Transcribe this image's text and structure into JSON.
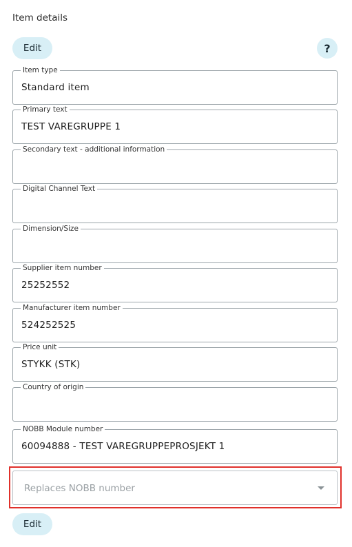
{
  "header": {
    "title": "Item details",
    "edit_label": "Edit",
    "help_label": "?"
  },
  "fields": [
    {
      "label": "Item type",
      "value": "Standard item"
    },
    {
      "label": "Primary text",
      "value": "TEST VAREGRUPPE 1"
    },
    {
      "label": "Secondary text - additional information",
      "value": ""
    },
    {
      "label": "Digital Channel Text",
      "value": ""
    },
    {
      "label": "Dimension/Size",
      "value": ""
    },
    {
      "label": "Supplier item number",
      "value": "25252552"
    },
    {
      "label": "Manufacturer item number",
      "value": "524252525"
    },
    {
      "label": "Price unit",
      "value": "STYKK (STK)"
    },
    {
      "label": "Country of origin",
      "value": ""
    },
    {
      "label": "NOBB Module number",
      "value": "60094888 - TEST VAREGRUPPEPROSJEKT 1"
    }
  ],
  "replaces_nobb": {
    "placeholder": "Replaces NOBB number",
    "value": "",
    "icon": "chevron-down-icon",
    "highlight_color": "#e0302a"
  },
  "footer": {
    "edit_label": "Edit"
  },
  "colors": {
    "button_bg": "#d8eff6",
    "field_border": "#9aa3a8"
  }
}
